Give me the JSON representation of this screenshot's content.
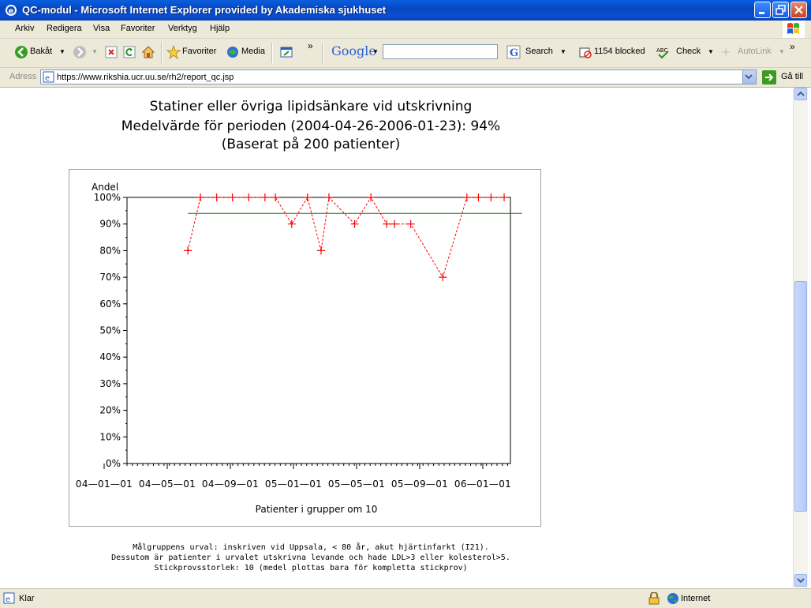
{
  "window": {
    "title": "QC-modul - Microsoft Internet Explorer provided by Akademiska sjukhuset"
  },
  "menu": [
    "Arkiv",
    "Redigera",
    "Visa",
    "Favoriter",
    "Verktyg",
    "Hjälp"
  ],
  "toolbar": {
    "back_label": "Bakåt",
    "favorites_label": "Favoriter",
    "media_label": "Media",
    "chevron": "»",
    "google_label": "Google",
    "search_label": "Search",
    "blocked_label": "1154 blocked",
    "check_label": "Check",
    "autolink_label": "AutoLink",
    "google_query": ""
  },
  "address": {
    "label": "Adress",
    "url": "https://www.rikshia.ucr.uu.se/rh2/report_qc.jsp",
    "go_label": "Gå till"
  },
  "report": {
    "title_line1": "Statiner eller övriga lipidsänkare vid utskrivning",
    "title_line2": "Medelvärde för perioden (2004-04-26-2006-01-23): 94%",
    "title_line3": "(Baserat på 200 patienter)",
    "footnote_line1": "Målgruppens urval: inskriven vid Uppsala, < 80 år, akut hjärtinfarkt (I21).",
    "footnote_line2": "Dessutom är patienter i urvalet utskrivna levande och hade LDL>3 eller kolesterol>5.",
    "footnote_line3": "Stickprovsstorlek: 10 (medel plottas bara för kompletta stickprov)"
  },
  "chart_data": {
    "type": "line",
    "ylabel": "Andel",
    "xlabel": "Patienter i grupper om 10",
    "y_ticks": [
      "0%",
      "10%",
      "20%",
      "30%",
      "40%",
      "50%",
      "60%",
      "70%",
      "80%",
      "90%",
      "100%"
    ],
    "ylim": [
      0,
      100
    ],
    "x_ticks": [
      "04-01-01",
      "04-05-01",
      "04-09-01",
      "05-01-01",
      "05-05-01",
      "05-09-01",
      "06-01-01"
    ],
    "xlim": [
      "2004-01-01",
      "2006-01-01"
    ],
    "series": [
      {
        "color": "#ff0000",
        "marker": "+",
        "line_style": "dashed",
        "points": [
          {
            "x": "2004-04-26",
            "y": 80
          },
          {
            "x": "2004-05-20",
            "y": 100
          },
          {
            "x": "2004-06-20",
            "y": 100
          },
          {
            "x": "2004-07-20",
            "y": 100
          },
          {
            "x": "2004-08-20",
            "y": 100
          },
          {
            "x": "2004-09-20",
            "y": 100
          },
          {
            "x": "2004-10-10",
            "y": 100
          },
          {
            "x": "2004-11-10",
            "y": 90
          },
          {
            "x": "2004-12-10",
            "y": 100
          },
          {
            "x": "2005-01-05",
            "y": 80
          },
          {
            "x": "2005-01-20",
            "y": 100
          },
          {
            "x": "2005-03-10",
            "y": 90
          },
          {
            "x": "2005-04-10",
            "y": 100
          },
          {
            "x": "2005-05-10",
            "y": 90
          },
          {
            "x": "2005-05-25",
            "y": 90
          },
          {
            "x": "2005-06-25",
            "y": 90
          },
          {
            "x": "2005-08-25",
            "y": 70
          },
          {
            "x": "2005-10-10",
            "y": 100
          },
          {
            "x": "2005-11-01",
            "y": 100
          },
          {
            "x": "2005-11-25",
            "y": 100
          },
          {
            "x": "2005-12-20",
            "y": 100
          }
        ]
      },
      {
        "color": "#008000",
        "marker": "none",
        "line_style": "solid",
        "points": [
          {
            "x": "2004-04-26",
            "y": 94
          },
          {
            "x": "2006-01-23",
            "y": 94
          }
        ]
      }
    ]
  },
  "status": {
    "text": "Klar",
    "zone": "Internet"
  }
}
